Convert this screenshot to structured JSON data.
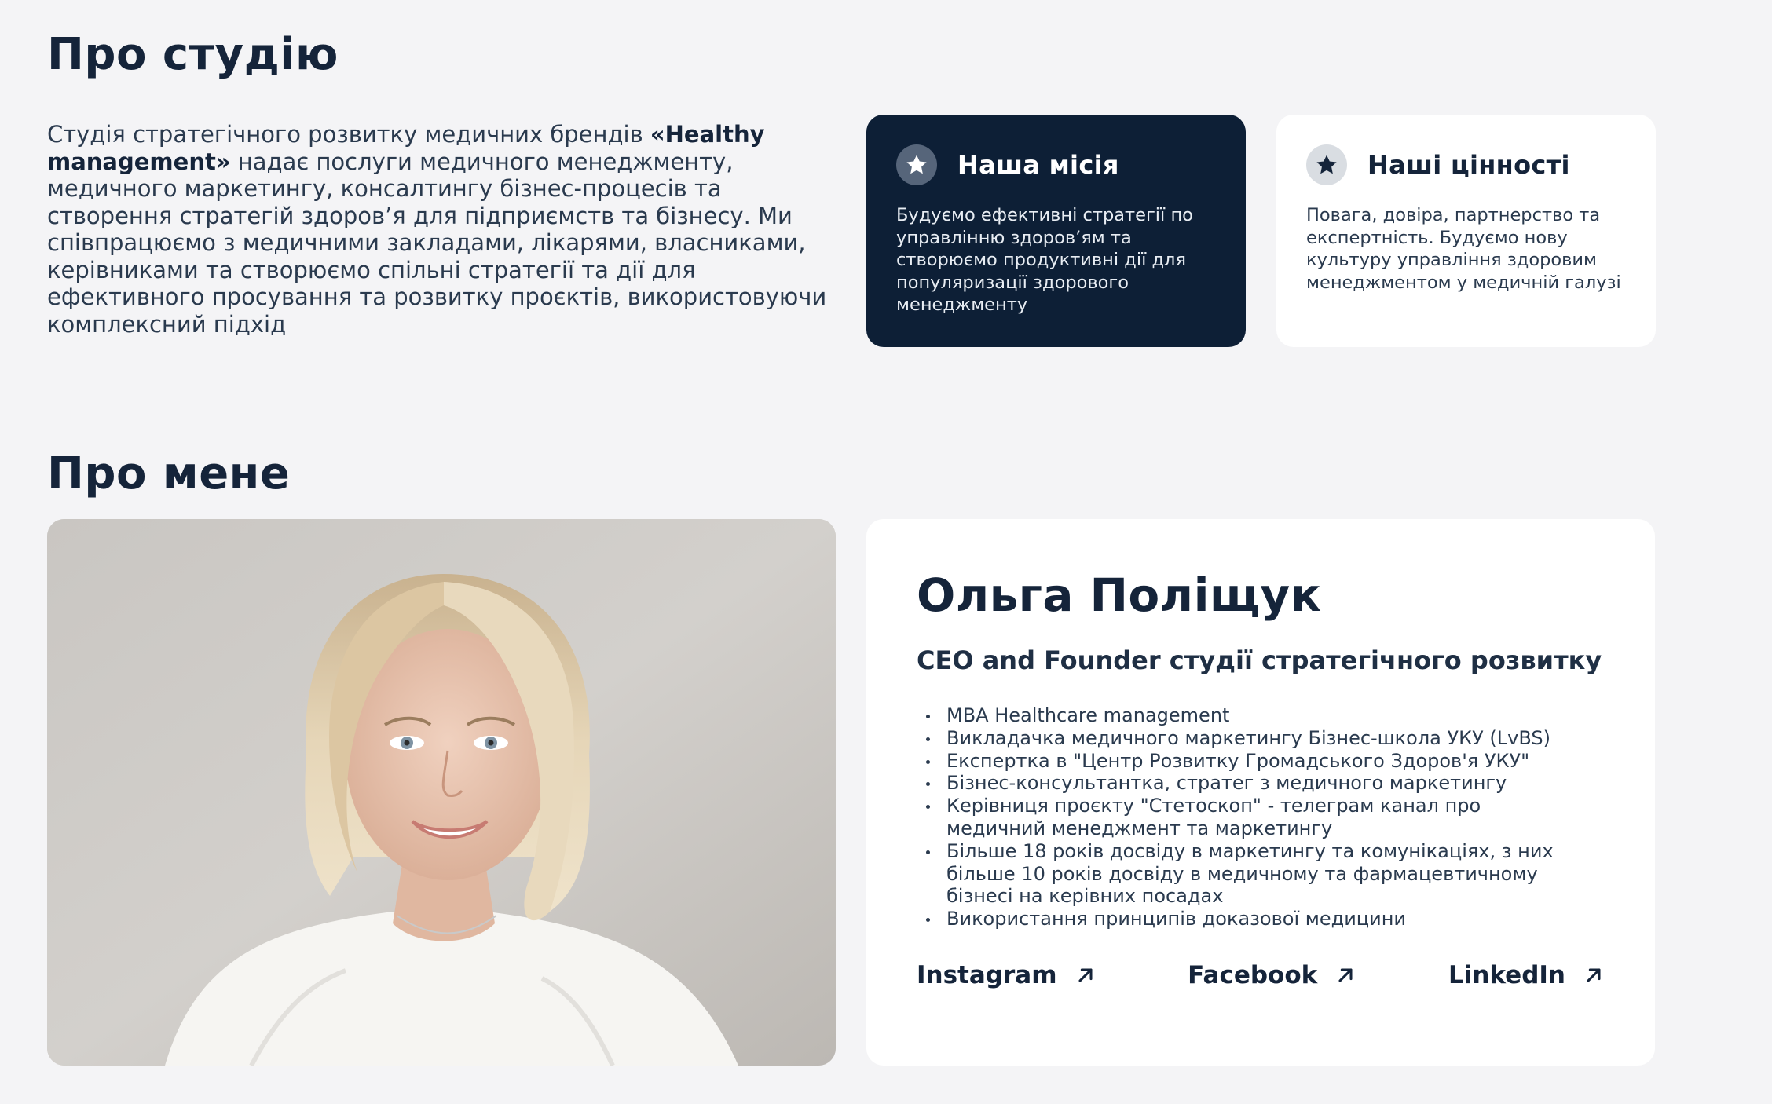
{
  "studio": {
    "title": "Про студію",
    "intro_part1": "Студія стратегічного розвитку медичних брендів ",
    "intro_brand": "«Healthy management»",
    "intro_part2": " надає послуги медичного менеджменту, медичного маркетингу, консалтингу бізнес-процесів та створення стратегій здоров’я для підприємств та бізнесу. Ми співпрацюємо з медичними закладами, лікарями, власниками, керівниками та створюємо спільні стратегії та дії для ефективного просування та розвитку проєктів, використовуючи комплексний підхід",
    "mission": {
      "icon": "star-icon",
      "title": "Наша місія",
      "text": "Будуємо ефективні стратегії по управлінню здоров’ям та створюємо продуктивні дії для популяризації здорового менеджменту"
    },
    "values": {
      "icon": "star-icon",
      "title": "Наші цінності",
      "text": "Повага, довіра, партнерство та експертність. Будуємо нову культуру управління здоровим менеджментом у медичній галузі"
    }
  },
  "about_me": {
    "title": "Про мене",
    "name": "Ольга Поліщук",
    "role": "CEO and Founder студії стратегічного розвитку",
    "facts": [
      "MBA Healthcare management",
      "Викладачка медичного маркетингу Бізнес-школа УКУ (LvBS)",
      "Експертка в \"Центр Розвитку Громадського Здоров'я УКУ\"",
      "Бізнес-консультантка, стратег з медичного маркетингу",
      "Керівниця проєкту \"Стетоскоп\" - телеграм канал про медичний менеджмент та маркетингу",
      "Більше 18 років досвіду в маркетингу та комунікаціях, з них більше 10 років досвіду в медичному та фармацевтичному бізнесі на керівних посадах",
      "Використання принципів доказової медицини"
    ],
    "socials": {
      "instagram": "Instagram",
      "facebook": "Facebook",
      "linkedin": "LinkedIn"
    }
  },
  "colors": {
    "background": "#f4f4f6",
    "navy": "#0d1f36",
    "card": "#ffffff",
    "text": "#15243a"
  }
}
